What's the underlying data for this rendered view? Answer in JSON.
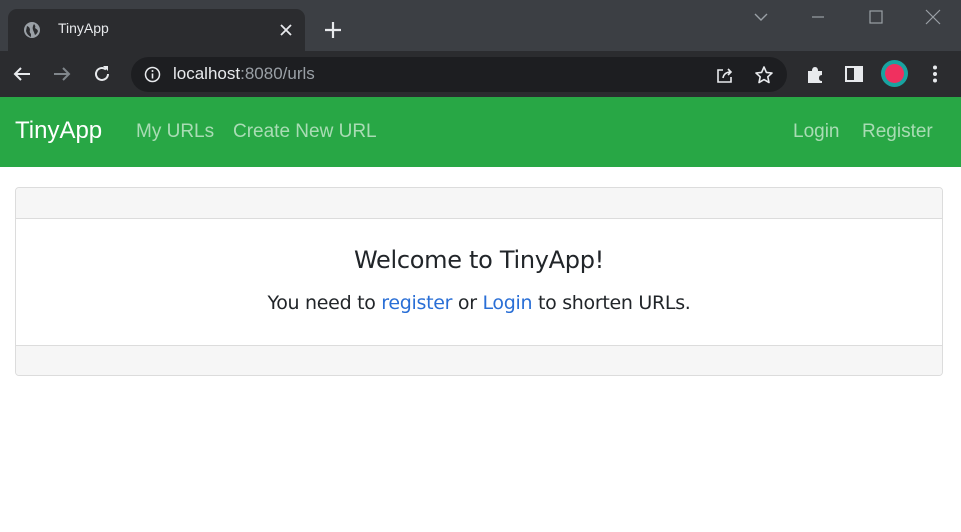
{
  "browser": {
    "tab": {
      "title": "TinyApp",
      "favicon": "globe-icon"
    },
    "address": {
      "host": "localhost",
      "path": ":8080/urls"
    },
    "colors": {
      "tabstrip": "#3c3f44",
      "toolbar": "#2b2c2f",
      "omnibox": "#1d1e21"
    }
  },
  "navbar": {
    "brand": "TinyApp",
    "links": {
      "my_urls": "My URLs",
      "create_url": "Create New URL",
      "login": "Login",
      "register": "Register"
    },
    "color": "#28a745"
  },
  "card": {
    "title": "Welcome to TinyApp!",
    "text": {
      "before": "You need to ",
      "register_link": "register",
      "middle": " or ",
      "login_link": "Login",
      "after": " to shorten URLs."
    },
    "link_color": "#2a6fd6"
  }
}
